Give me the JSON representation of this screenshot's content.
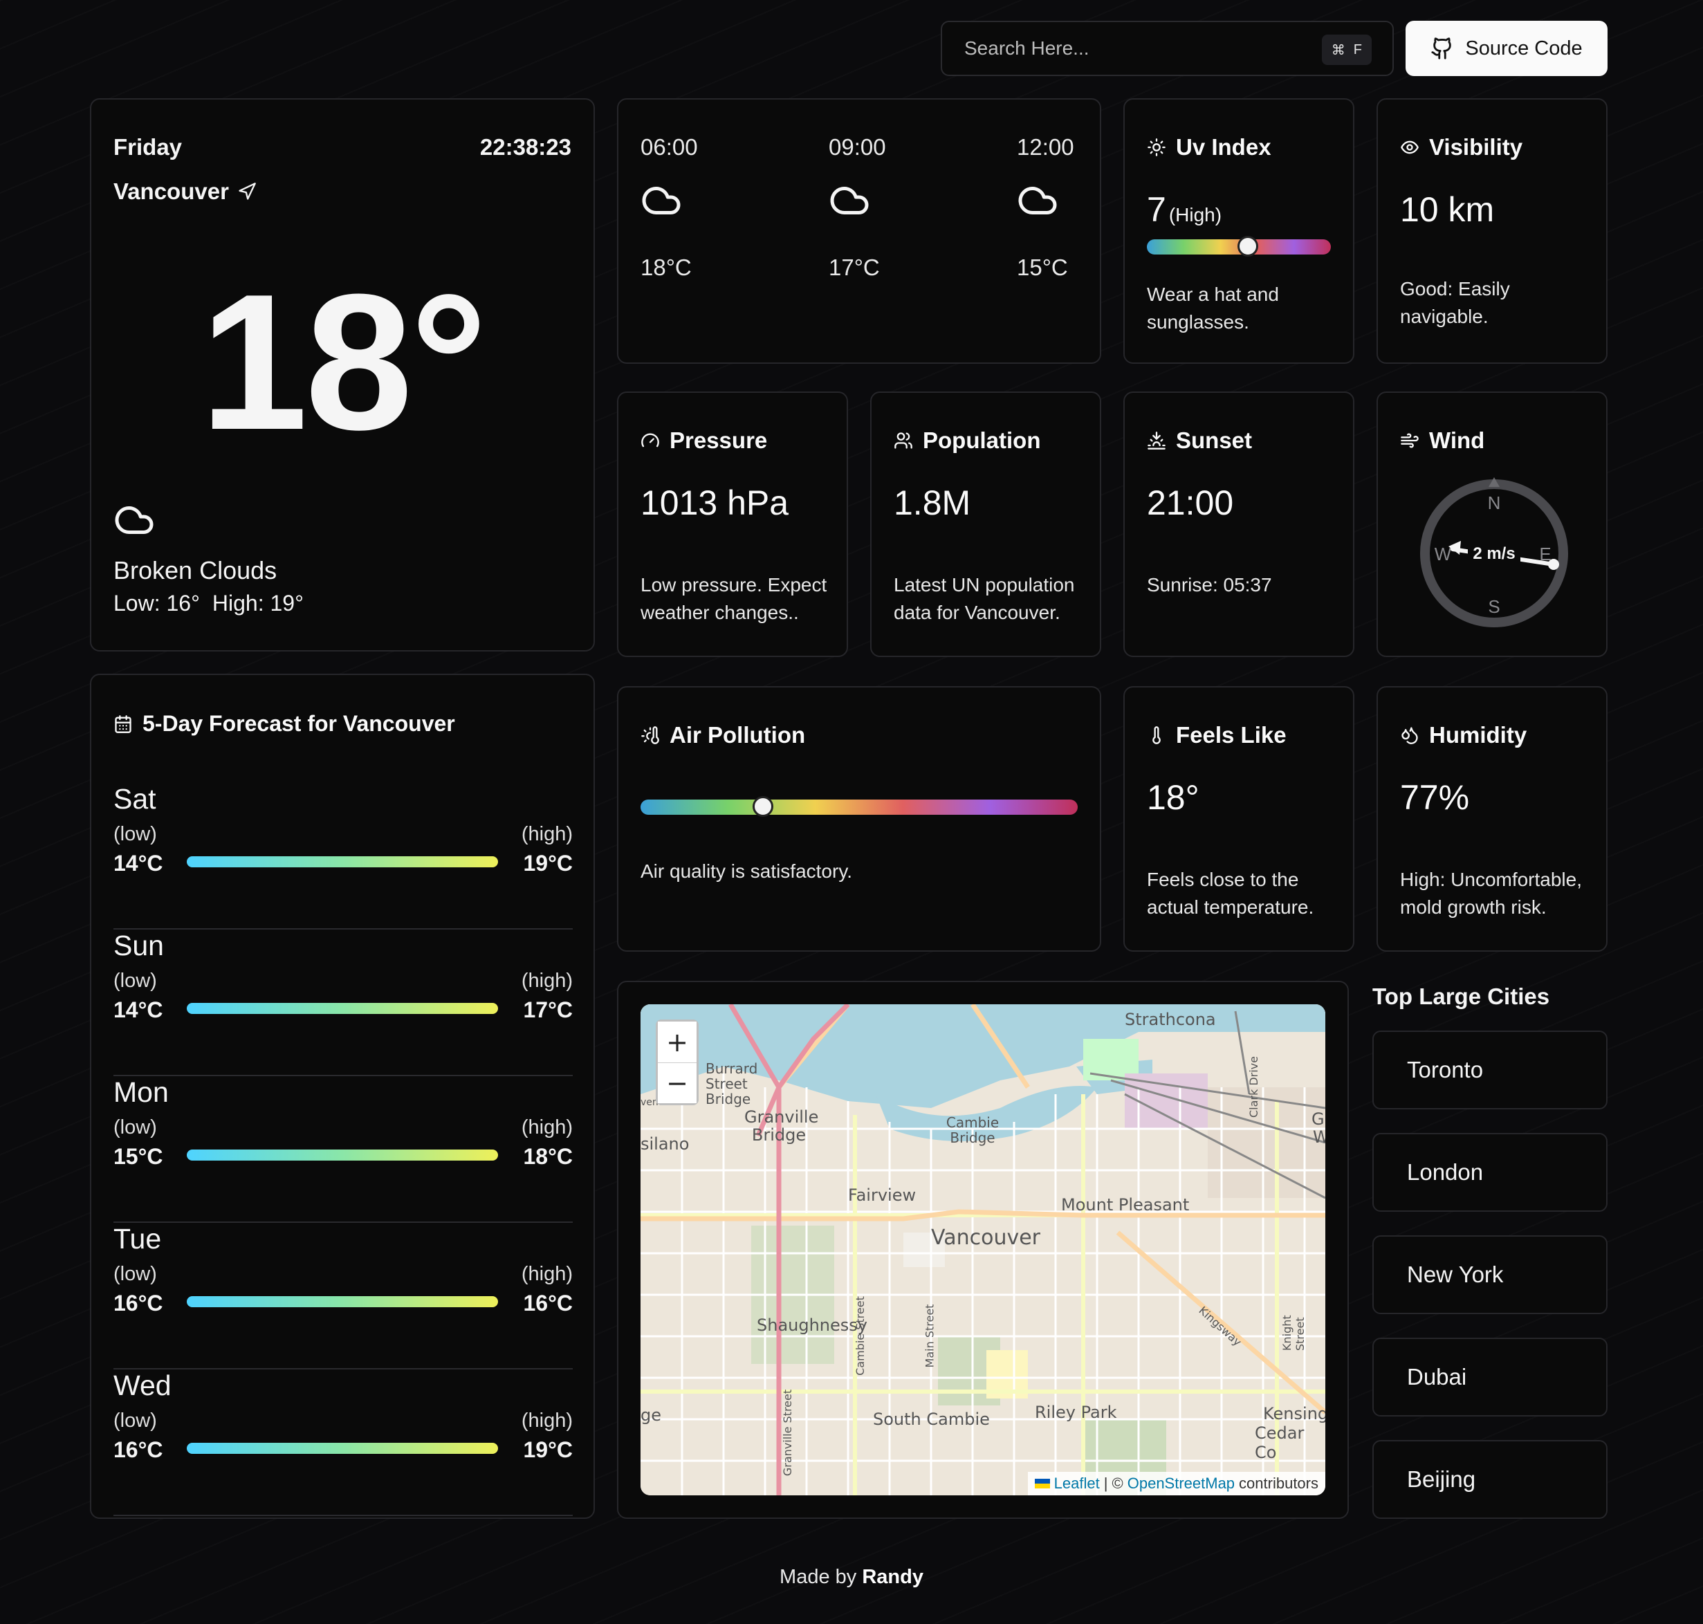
{
  "search": {
    "placeholder": "Search Here...",
    "shortcut_key": "F"
  },
  "source_button": {
    "label": "Source Code"
  },
  "current": {
    "day": "Friday",
    "time": "22:38:23",
    "city": "Vancouver",
    "temperature": "18°",
    "condition": "Broken Clouds",
    "low": "Low: 16°",
    "high": "High: 19°"
  },
  "hourly": [
    {
      "time": "06:00",
      "temp": "18°C",
      "icon": "cloud-icon"
    },
    {
      "time": "09:00",
      "temp": "17°C",
      "icon": "cloud-icon"
    },
    {
      "time": "12:00",
      "temp": "15°C",
      "icon": "cloud-icon"
    }
  ],
  "uv": {
    "title": "Uv Index",
    "value": "7",
    "level": "(High)",
    "fraction": 0.55,
    "advice": "Wear a hat and sunglasses."
  },
  "visibility": {
    "title": "Visibility",
    "value": "10 km",
    "desc": "Good: Easily navigable."
  },
  "pressure": {
    "title": "Pressure",
    "value": "1013 hPa",
    "desc": "Low pressure. Expect weather changes.."
  },
  "population": {
    "title": "Population",
    "value": "1.8M",
    "desc": "Latest UN population data for Vancouver."
  },
  "sunset": {
    "title": "Sunset",
    "value": "21:00",
    "sunrise": "Sunrise: 05:37"
  },
  "wind": {
    "title": "Wind",
    "speed": "2 m/s",
    "labels": {
      "n": "N",
      "e": "E",
      "s": "S",
      "w": "W"
    }
  },
  "air": {
    "title": "Air Pollution",
    "fraction": 0.28,
    "desc": "Air quality is satisfactory."
  },
  "feels": {
    "title": "Feels Like",
    "value": "18°",
    "desc": "Feels close to the actual temperature."
  },
  "humidity": {
    "title": "Humidity",
    "value": "77%",
    "desc": "High: Uncomfortable, mold growth risk."
  },
  "forecast": {
    "title": "5-Day Forecast for Vancouver",
    "low_label": "(low)",
    "high_label": "(high)",
    "days": [
      {
        "day": "Sat",
        "low": "14°C",
        "high": "19°C"
      },
      {
        "day": "Sun",
        "low": "14°C",
        "high": "17°C"
      },
      {
        "day": "Mon",
        "low": "15°C",
        "high": "18°C"
      },
      {
        "day": "Tue",
        "low": "16°C",
        "high": "16°C"
      },
      {
        "day": "Wed",
        "low": "16°C",
        "high": "19°C"
      }
    ]
  },
  "map": {
    "zoom_in": "+",
    "zoom_out": "−",
    "attribution_leaflet": "Leaflet",
    "attribution_sep": "| ©",
    "attribution_osm": "OpenStreetMap",
    "attribution_tail": "contributors",
    "labels": [
      "Strathcona",
      "Burrard Street Bridge",
      "Granville Bridge",
      "Cambie Bridge",
      "silano",
      "Fairview",
      "Mount Pleasant",
      "Vancouver",
      "Shaughnessy",
      "South Cambie",
      "Riley Park",
      "Kensing",
      "Cedar Co",
      "Kingsway",
      "Granville Street",
      "Cambie Street",
      "Main Street",
      "Knight Street",
      "Clark Drive",
      "venue",
      "ge",
      "Gl",
      "W"
    ]
  },
  "cities": {
    "title": "Top Large Cities",
    "items": [
      "Toronto",
      "London",
      "New York",
      "Dubai",
      "Beijing"
    ]
  },
  "footer": {
    "prefix": "Made by",
    "author": "Randy"
  }
}
